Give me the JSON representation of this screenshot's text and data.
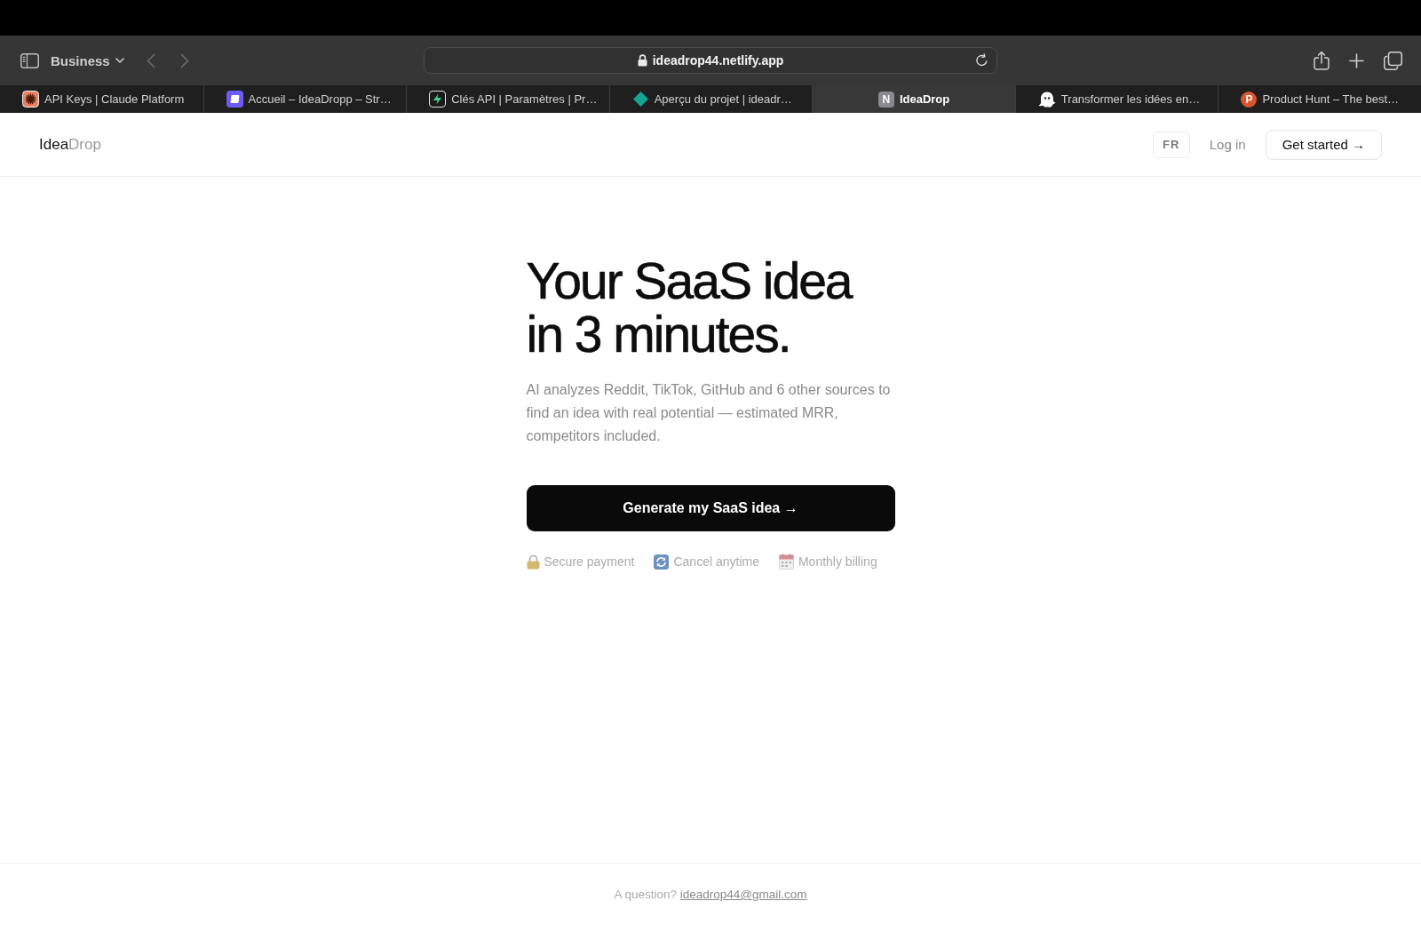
{
  "browser": {
    "tab_group": "Business",
    "navigation": [
      {
        "kind": "back",
        "disabled": true
      },
      {
        "kind": "forward",
        "disabled": true
      }
    ],
    "address": "ideadrop44.netlify.app",
    "tabs": [
      {
        "title": "API Keys | Claude Platform",
        "selected": false
      },
      {
        "title": "Accueil – IdeaDropp – Str…",
        "selected": false
      },
      {
        "title": "Clés API | Paramètres | Pr…",
        "selected": false
      },
      {
        "title": "Aperçu du projet | ideadr…",
        "selected": false
      },
      {
        "title": "IdeaDrop",
        "selected": true,
        "favicon_letter": "N"
      },
      {
        "title": "Transformer les idées en…",
        "selected": false
      },
      {
        "title": "Product Hunt – The best…",
        "selected": false,
        "favicon_letter": "P"
      }
    ]
  },
  "header": {
    "logo": {
      "text": "Idea",
      "accent": "Drop"
    },
    "language": "FR",
    "login": "Log in",
    "cta": "Get started →"
  },
  "hero": {
    "title_lines": [
      "Your SaaS idea",
      "in 3 minutes."
    ],
    "description": "AI analyzes Reddit, TikTok, GitHub and 6 other sources to find an idea with real potential — estimated MRR, competitors included.",
    "button": "Generate my SaaS idea →",
    "badges": [
      "Secure payment",
      "Cancel anytime",
      "Monthly billing"
    ]
  },
  "footer": {
    "text": "A question?",
    "email": "ideadrop44@gmail.com"
  }
}
